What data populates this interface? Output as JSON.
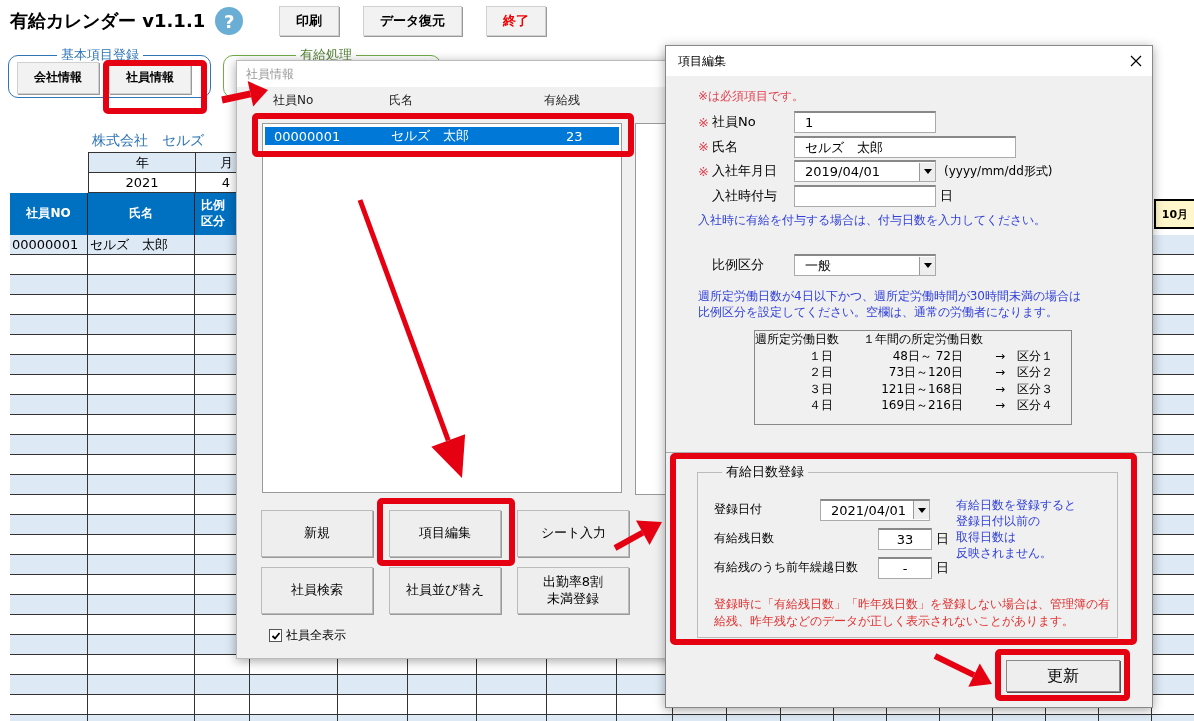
{
  "app": {
    "title": "有給カレンダー v1.1.1",
    "help_label": "?"
  },
  "toolbar_buttons": [
    {
      "label": "印刷",
      "kind": "normal"
    },
    {
      "label": "データ復元",
      "kind": "normal"
    },
    {
      "label": "終了",
      "kind": "danger"
    }
  ],
  "groups": [
    {
      "title": "基本項目登録",
      "kind": "basic",
      "buttons": [
        "会社情報",
        "社員情報"
      ]
    },
    {
      "title": "有給処理",
      "kind": "leave"
    }
  ],
  "company": "株式会社　セルズ",
  "period": {
    "headers": [
      "年",
      "月"
    ],
    "values": [
      "2021",
      "4"
    ]
  },
  "sheet": {
    "columns": [
      "社員NO",
      "氏名",
      "比例区分"
    ],
    "rows": [
      {
        "employee_no": "00000001",
        "name": "セルズ　太郎"
      }
    ],
    "month_header": "10月"
  },
  "employee_dialog": {
    "title": "社員情報",
    "columns": [
      "社員No",
      "氏名",
      "有給残"
    ],
    "items": [
      {
        "no": "00000001",
        "name": "セルズ　太郎",
        "balance": "23",
        "selected": true
      }
    ],
    "buttons": [
      "新規",
      "項目編集",
      "シート入力",
      "社員検索",
      "社員並び替え",
      "出勤率8割未満登録"
    ],
    "show_all": {
      "label": "社員全表示",
      "checked": true
    }
  },
  "edit_dialog": {
    "title": "項目編集",
    "required_note": "※は必須項目です。",
    "fields": [
      {
        "label": "社員No",
        "required_mark": "※",
        "kind": "text",
        "value": "1"
      },
      {
        "label": "氏名",
        "required_mark": "※",
        "kind": "wide",
        "value": "セルズ　太郎"
      },
      {
        "label": "入社年月日",
        "required_mark": "※",
        "kind": "combo",
        "value": "2019/04/01",
        "hint": "(yyyy/mm/dd形式)"
      },
      {
        "label": "入社時付与",
        "kind": "text",
        "unit": "日"
      }
    ],
    "grant_note": "入社時に有給を付与する場合は、付与日数を入力してください。",
    "ratio": {
      "label": "比例区分",
      "value": "一般"
    },
    "ratio_note": "週所定労働日数が4日以下かつ、週所定労働時間が30時間未満の場合は比例区分を設定してください。空欄は、通常の労働者になります。",
    "ratio_table": {
      "headers": [
        "週所定労働日数",
        "１年間の所定労働日数"
      ],
      "rows": [
        [
          "１日",
          "48日～ 72日",
          "→　区分１"
        ],
        [
          "２日",
          "73日～120日",
          "→　区分２"
        ],
        [
          "３日",
          "121日～168日",
          "→　区分３"
        ],
        [
          "４日",
          "169日～216日",
          "→　区分４"
        ]
      ]
    },
    "leave": {
      "title": "有給日数登録",
      "fields": [
        {
          "label": "登録日付",
          "kind": "combo",
          "value": "2021/04/01"
        },
        {
          "label": "有給残日数",
          "kind": "text",
          "value": "33",
          "unit": "日"
        },
        {
          "label": "有給残のうち前年繰越日数",
          "kind": "text",
          "value": "-",
          "unit": "日"
        }
      ],
      "side_note_lines": [
        "有給日数を登録すると",
        "登録日付以前の",
        "取得日数は",
        "反映されません。"
      ],
      "warning": "登録時に「有給残日数」「昨年残日数」を登録しない場合は、管理簿の有給残、昨年残などのデータが正しく表示されないことがあります。"
    },
    "submit": "更新"
  }
}
